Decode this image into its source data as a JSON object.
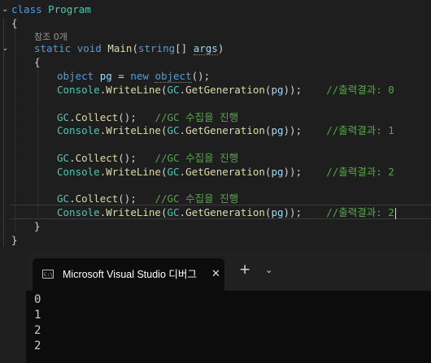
{
  "editor": {
    "class_keyword": "class",
    "class_name": "Program",
    "codelens": "참조 0개",
    "static_kw": "static",
    "void_kw": "void",
    "main_name": "Main",
    "string_kw": "string",
    "args_name": "args",
    "object_type": "object",
    "var_pg": "pg",
    "new_kw": "new",
    "object_kw": "object",
    "console_class": "Console",
    "writeline": "WriteLine",
    "gc_class": "GC",
    "getgeneration": "GetGeneration",
    "collect": "Collect",
    "comment_collect": "//GC 수집을 진행",
    "comment_result_0": "//출력결과: 0",
    "comment_result_1": "//출력결과: 1",
    "comment_result_2a": "//출력결과: 2",
    "comment_result_2b": "//출력결과: 2"
  },
  "terminal": {
    "tab_icon": "C:\\",
    "tab_title": "Microsoft Visual Studio 디버그",
    "close_glyph": "✕",
    "new_tab_glyph": "+",
    "dropdown_glyph": "⌄",
    "output": [
      "0",
      "1",
      "2",
      "2"
    ]
  },
  "colors": {
    "keyword": "#569cd6",
    "type": "#4ec9b0",
    "method": "#dcdcaa",
    "variable": "#9cdcfe",
    "comment": "#57a64a",
    "background": "#1e1e1e",
    "terminal_bg": "#0c0c0c"
  },
  "icons": {
    "fold": "chevron-down-icon",
    "terminal": "console-icon",
    "close": "close-icon",
    "add": "plus-icon",
    "menu": "chevron-down-icon"
  }
}
